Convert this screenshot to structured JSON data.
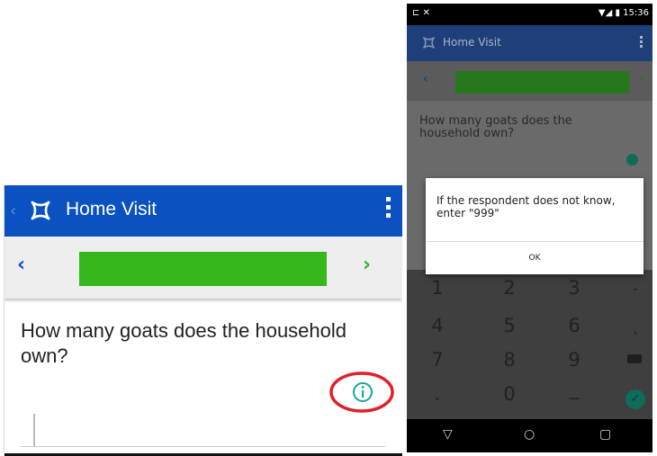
{
  "left": {
    "app_title": "Home Visit",
    "question": "How many goats does the household own?",
    "prev_glyph": "‹",
    "next_glyph": "›"
  },
  "right": {
    "status_time": "15:36",
    "app_title": "Home Visit",
    "question": "How many goats does the household own?",
    "dialog_message": "If the respondent does not know, enter \"999\"",
    "dialog_ok": "OK",
    "keypad_keys": [
      "1",
      "2",
      "3",
      "-",
      "4",
      "5",
      "6",
      ",",
      "7",
      "8",
      "9",
      ".",
      "0",
      "_"
    ]
  },
  "colors": {
    "appbar": "#0b51c1",
    "progress": "#36b71b",
    "info_icon": "#13a89e",
    "highlight_ring": "#e0202a"
  }
}
